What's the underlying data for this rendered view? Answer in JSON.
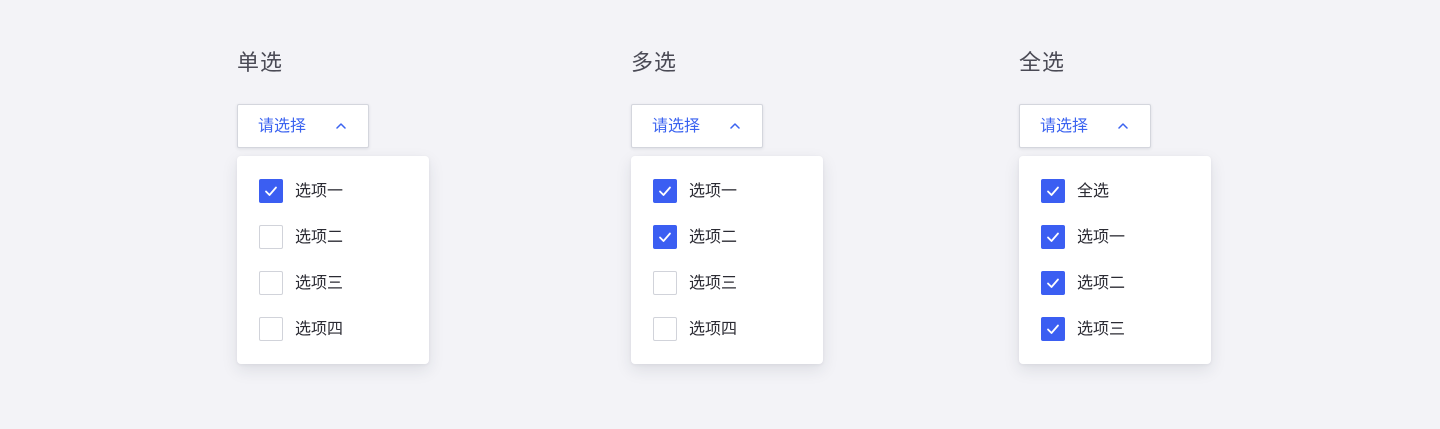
{
  "groups": [
    {
      "title": "单选",
      "trigger": {
        "label": "请选择",
        "icon": "chevron-up-icon"
      },
      "options": [
        {
          "label": "选项一",
          "checked": true
        },
        {
          "label": "选项二",
          "checked": false
        },
        {
          "label": "选项三",
          "checked": false
        },
        {
          "label": "选项四",
          "checked": false
        }
      ]
    },
    {
      "title": "多选",
      "trigger": {
        "label": "请选择",
        "icon": "chevron-up-icon"
      },
      "options": [
        {
          "label": "选项一",
          "checked": true
        },
        {
          "label": "选项二",
          "checked": true
        },
        {
          "label": "选项三",
          "checked": false
        },
        {
          "label": "选项四",
          "checked": false
        }
      ]
    },
    {
      "title": "全选",
      "trigger": {
        "label": "请选择",
        "icon": "chevron-up-icon"
      },
      "options": [
        {
          "label": "全选",
          "checked": true
        },
        {
          "label": "选项一",
          "checked": true
        },
        {
          "label": "选项二",
          "checked": true
        },
        {
          "label": "选项三",
          "checked": true
        }
      ]
    }
  ],
  "colors": {
    "background": "#f3f3f7",
    "accent": "#3b5ef2",
    "trigger_text": "#3b63f0",
    "title_text": "#4a4a55",
    "option_text": "#2b2b33",
    "checkbox_border": "#d1d3da"
  }
}
